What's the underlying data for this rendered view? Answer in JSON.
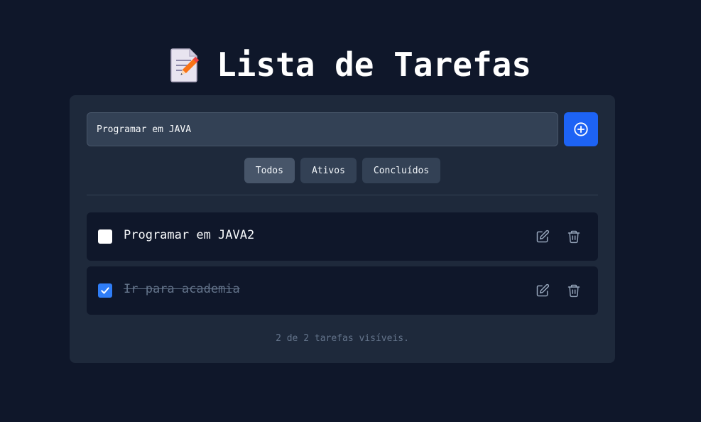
{
  "header": {
    "title": "Lista de Tarefas",
    "icon": "memo-pencil-icon"
  },
  "add_form": {
    "input_value": "Programar em JAVA",
    "add_icon": "plus-circle-icon"
  },
  "filters": [
    {
      "label": "Todos",
      "active": true
    },
    {
      "label": "Ativos",
      "active": false
    },
    {
      "label": "Concluídos",
      "active": false
    }
  ],
  "tasks": [
    {
      "text": "Programar em JAVA2",
      "done": false,
      "edit_icon": "edit-icon",
      "delete_icon": "trash-icon"
    },
    {
      "text": "Ir para academia",
      "done": true,
      "edit_icon": "edit-icon",
      "delete_icon": "trash-icon"
    }
  ],
  "footer": {
    "summary": "2 de 2 tarefas visíveis."
  },
  "colors": {
    "background": "#0f172a",
    "card": "#1e293b",
    "accent": "#1d63f5",
    "muted": "#64748b"
  }
}
